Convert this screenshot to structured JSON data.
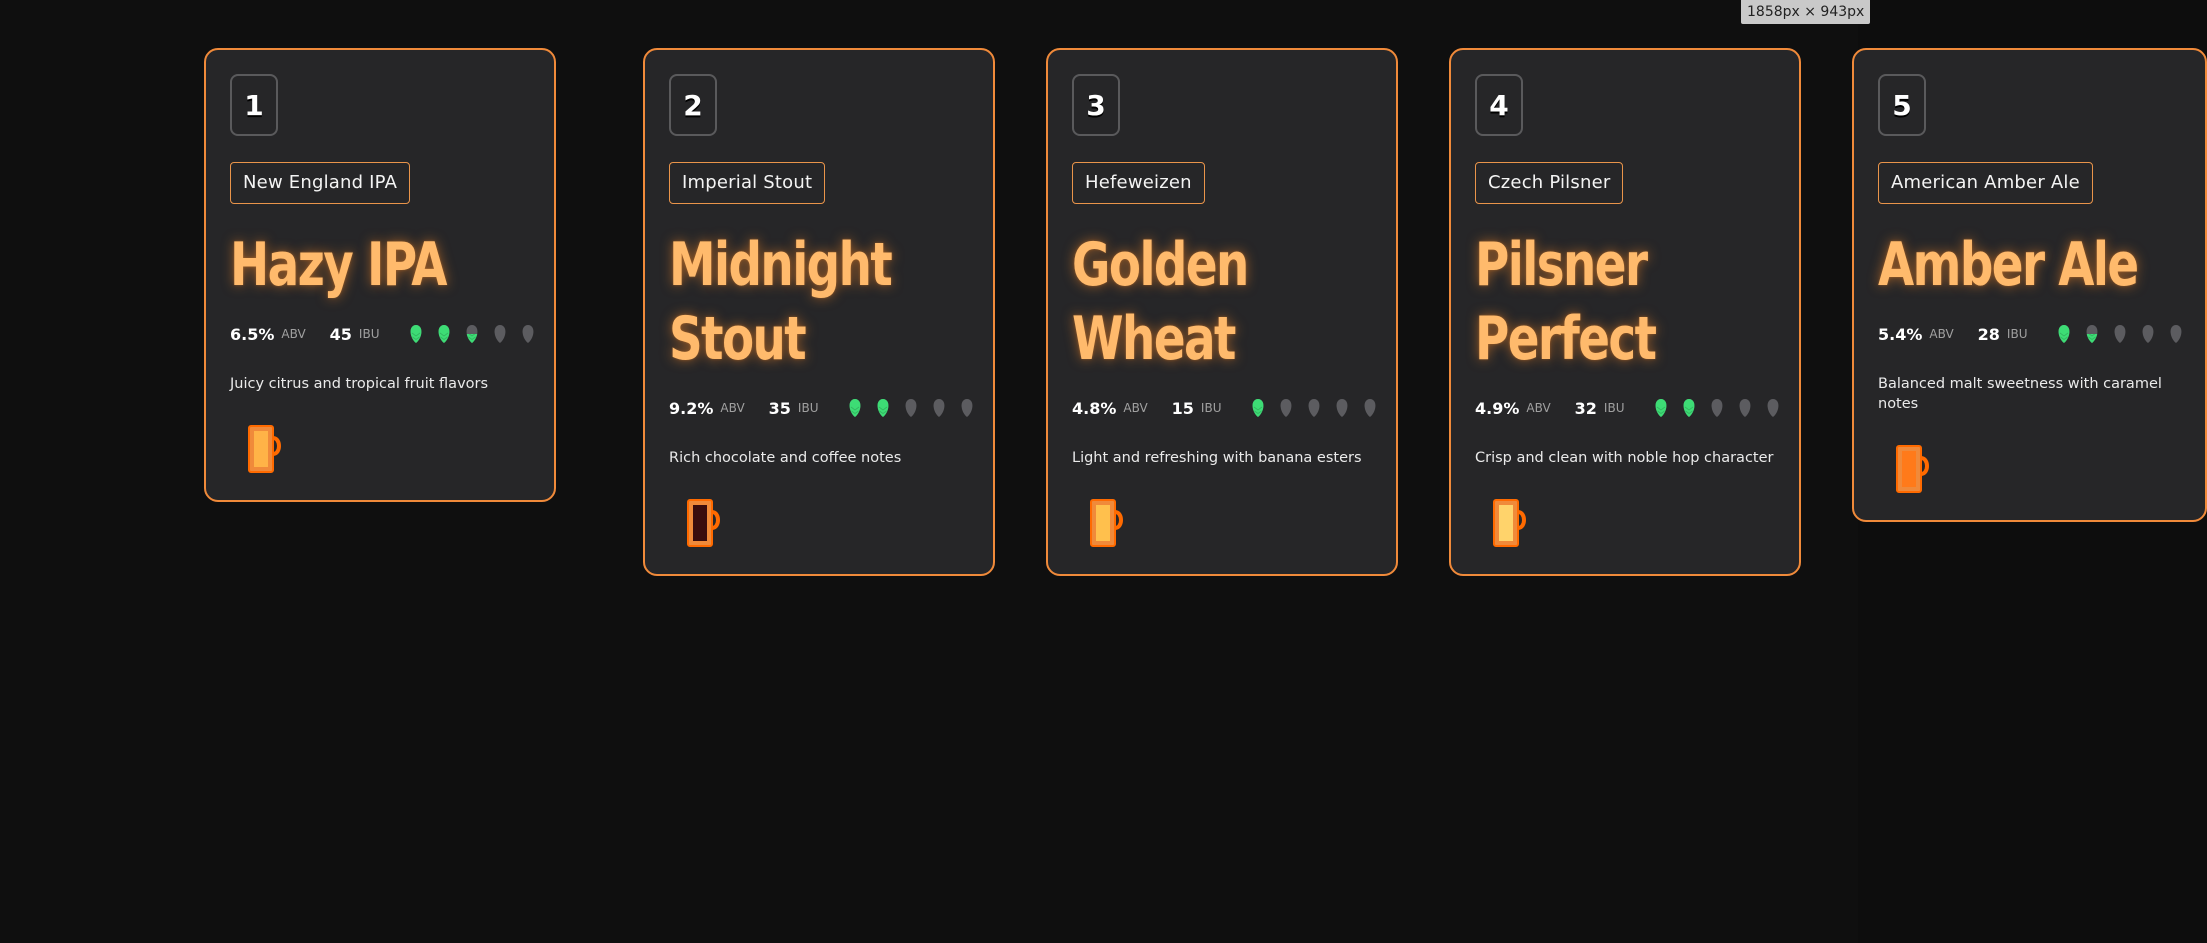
{
  "tooltip": "1858px × 943px",
  "colors": {
    "accent": "#f08a3a",
    "title_glow": "#ffba6c",
    "hop_filled": "#3ddc75",
    "hop_empty": "#5c5c60",
    "card_bg": "#262628",
    "page_bg": "#0f0f0f"
  },
  "beers": [
    {
      "number": "1",
      "style": "New England IPA",
      "name_line1": "Hazy IPA",
      "name_line2": "",
      "abv": "6.5%",
      "abv_label": "ABV",
      "ibu": "45",
      "ibu_label": "IBU",
      "hop_rating": 2.5,
      "hop_max": 5,
      "description": "Juicy citrus and tropical fruit flavors",
      "mug_icon": "beer-mug-icon",
      "mug_fill": "#ffb347"
    },
    {
      "number": "2",
      "style": "Imperial Stout",
      "name_line1": "Midnight",
      "name_line2": "Stout",
      "abv": "9.2%",
      "abv_label": "ABV",
      "ibu": "35",
      "ibu_label": "IBU",
      "hop_rating": 2,
      "hop_max": 5,
      "description": "Rich chocolate and coffee notes",
      "mug_icon": "beer-mug-icon",
      "mug_fill": "#3a0d0d"
    },
    {
      "number": "3",
      "style": "Hefeweizen",
      "name_line1": "Golden",
      "name_line2": "Wheat",
      "abv": "4.8%",
      "abv_label": "ABV",
      "ibu": "15",
      "ibu_label": "IBU",
      "hop_rating": 1,
      "hop_max": 5,
      "description": "Light and refreshing with banana esters",
      "mug_icon": "beer-mug-icon",
      "mug_fill": "#ffc04d"
    },
    {
      "number": "4",
      "style": "Czech Pilsner",
      "name_line1": "Pilsner",
      "name_line2": "Perfect",
      "abv": "4.9%",
      "abv_label": "ABV",
      "ibu": "32",
      "ibu_label": "IBU",
      "hop_rating": 2,
      "hop_max": 5,
      "description": "Crisp and clean with noble hop character",
      "mug_icon": "beer-mug-icon",
      "mug_fill": "#ffd36b"
    },
    {
      "number": "5",
      "style": "American Amber Ale",
      "name_line1": "Amber Ale",
      "name_line2": "",
      "abv": "5.4%",
      "abv_label": "ABV",
      "ibu": "28",
      "ibu_label": "IBU",
      "hop_rating": 1.5,
      "hop_max": 5,
      "description": "Balanced malt sweetness with caramel notes",
      "mug_icon": "beer-mug-icon",
      "mug_fill": "#ff7a1a"
    }
  ]
}
